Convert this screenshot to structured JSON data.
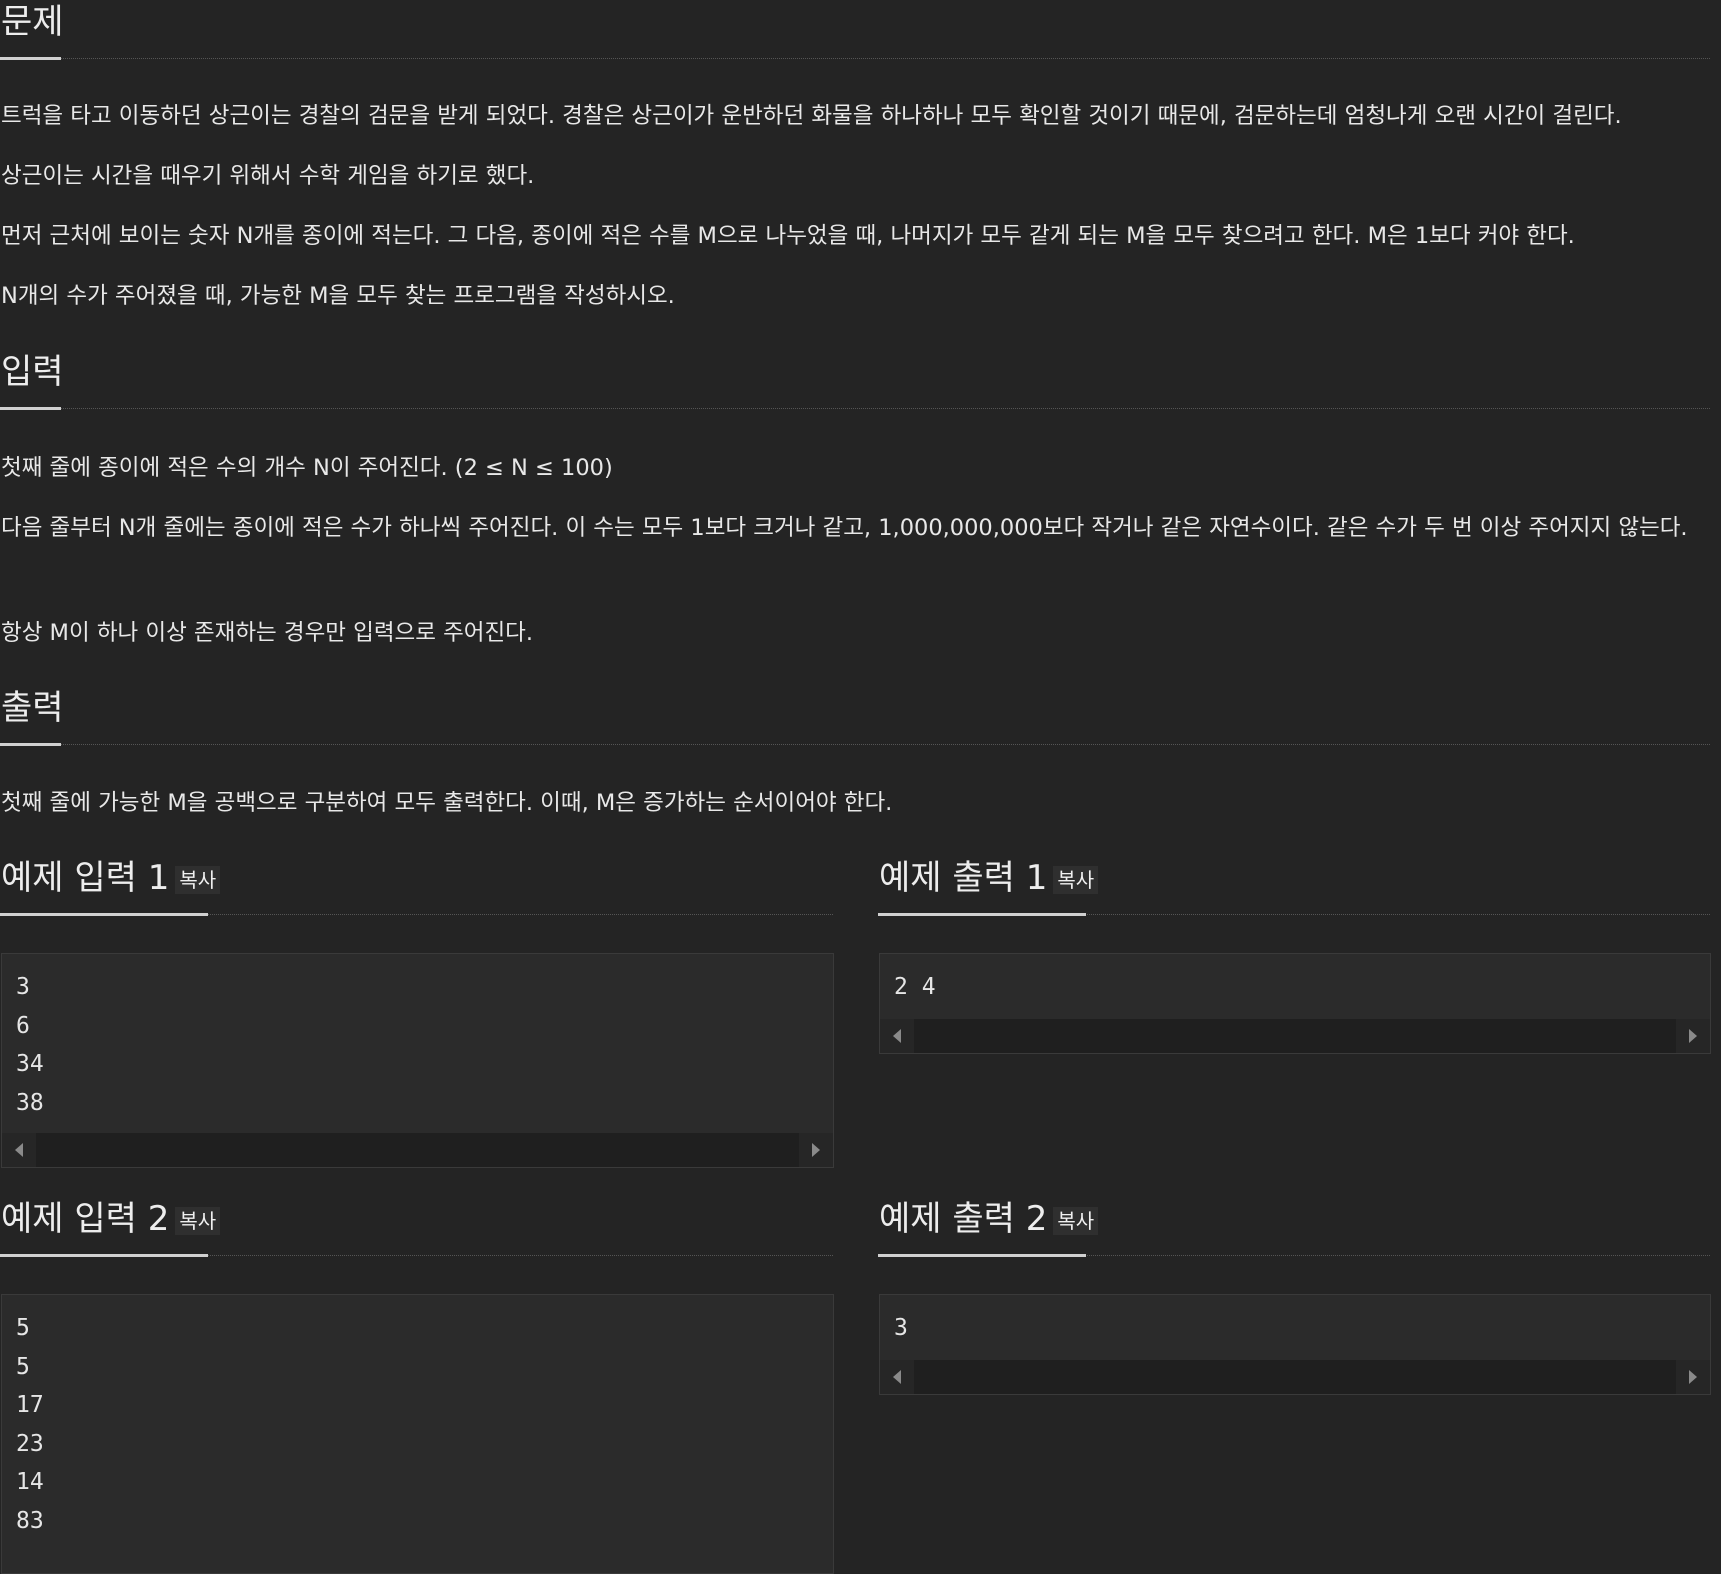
{
  "problem": {
    "heading": "문제",
    "paragraphs": [
      "트럭을 타고 이동하던 상근이는 경찰의 검문을 받게 되었다. 경찰은 상근이가 운반하던 화물을 하나하나 모두 확인할 것이기 때문에, 검문하는데 엄청나게 오랜 시간이 걸린다.",
      "상근이는 시간을 때우기 위해서 수학 게임을 하기로 했다.",
      "먼저 근처에 보이는 숫자 N개를 종이에 적는다. 그 다음, 종이에 적은 수를 M으로 나누었을 때, 나머지가 모두 같게 되는 M을 모두 찾으려고 한다. M은 1보다 커야 한다.",
      "N개의 수가 주어졌을 때, 가능한 M을 모두 찾는 프로그램을 작성하시오."
    ]
  },
  "input": {
    "heading": "입력",
    "paragraphs": [
      "첫째 줄에 종이에 적은 수의 개수 N이 주어진다. (2 ≤ N ≤ 100)",
      "다음 줄부터 N개 줄에는 종이에 적은 수가 하나씩 주어진다. 이 수는 모두 1보다 크거나 같고, 1,000,000,000보다 작거나 같은 자연수이다. 같은 수가 두 번 이상 주어지지 않는다.",
      "항상 M이 하나 이상 존재하는 경우만 입력으로 주어진다."
    ]
  },
  "output": {
    "heading": "출력",
    "paragraphs": [
      "첫째 줄에 가능한 M을 공백으로 구분하여 모두 출력한다. 이때, M은 증가하는 순서이어야 한다."
    ]
  },
  "copy_label": "복사",
  "samples": [
    {
      "input_title": "예제 입력 1",
      "output_title": "예제 출력 1",
      "input_lines": [
        "3",
        "6",
        "34",
        "38"
      ],
      "output_lines": [
        "2 4"
      ]
    },
    {
      "input_title": "예제 입력 2",
      "output_title": "예제 출력 2",
      "input_lines": [
        "5",
        "5",
        "17",
        "23",
        "14",
        "83"
      ],
      "output_lines": [
        "3"
      ]
    }
  ]
}
